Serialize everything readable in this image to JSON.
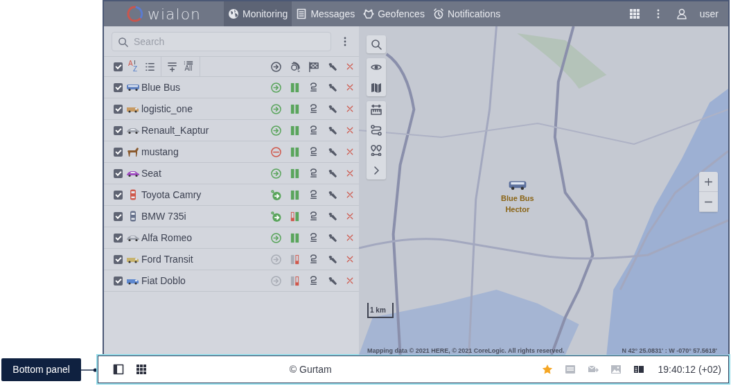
{
  "callout": {
    "label": "Bottom panel"
  },
  "top_bar": {
    "logo": "wialon",
    "tabs": [
      {
        "label": "Monitoring",
        "selected": true
      },
      {
        "label": "Messages",
        "selected": false
      },
      {
        "label": "Geofences",
        "selected": false
      },
      {
        "label": "Notifications",
        "selected": false
      }
    ],
    "user": "user"
  },
  "unit_list": {
    "search": {
      "placeholder": "Search"
    },
    "header": {
      "checked": true,
      "sort_letters": [
        "A",
        "Z"
      ],
      "all_label": "All"
    },
    "units": [
      {
        "name": "Blue Bus",
        "kind": "bus",
        "color": "#5d7fbf",
        "checked": true,
        "online": true,
        "stopped": false,
        "engine_on": false,
        "position_valid": true,
        "connected": true
      },
      {
        "name": "logistic_one",
        "kind": "van",
        "color": "#c79a62",
        "checked": true,
        "online": true,
        "stopped": false,
        "engine_on": false,
        "position_valid": true,
        "connected": true
      },
      {
        "name": "Renault_Kaptur",
        "kind": "car",
        "color": "#9ea3ad",
        "checked": true,
        "online": true,
        "stopped": false,
        "engine_on": false,
        "position_valid": true,
        "connected": true
      },
      {
        "name": "mustang",
        "kind": "horse",
        "color": "#8a5a2e",
        "checked": true,
        "online": true,
        "stopped": true,
        "engine_on": false,
        "position_valid": true,
        "connected": true
      },
      {
        "name": "Seat",
        "kind": "car",
        "color": "#a14fc2",
        "checked": true,
        "online": true,
        "stopped": false,
        "engine_on": false,
        "position_valid": true,
        "connected": true
      },
      {
        "name": "Toyota Camry",
        "kind": "topcar",
        "color": "#cf5a4c",
        "checked": true,
        "online": true,
        "stopped": false,
        "engine_on": true,
        "position_valid": true,
        "connected": true
      },
      {
        "name": "BMW 735i",
        "kind": "topcar",
        "color": "#67728c",
        "checked": true,
        "online": true,
        "stopped": false,
        "engine_on": true,
        "position_valid": false,
        "connected": true
      },
      {
        "name": "Alfa Romeo",
        "kind": "car",
        "color": "#9ea3ad",
        "checked": true,
        "online": true,
        "stopped": false,
        "engine_on": false,
        "position_valid": true,
        "connected": true
      },
      {
        "name": "Ford Transit",
        "kind": "van",
        "color": "#c7b36e",
        "checked": true,
        "online": false,
        "stopped": false,
        "engine_on": false,
        "position_valid": true,
        "connected": false
      },
      {
        "name": "Fiat Doblo",
        "kind": "van",
        "color": "#5e88cf",
        "checked": true,
        "online": false,
        "stopped": false,
        "engine_on": false,
        "position_valid": true,
        "connected": false
      }
    ]
  },
  "map": {
    "unit_labels": [
      "Blue Bus",
      "Hector"
    ],
    "scale": "1 km",
    "attribution": "Mapping data © 2021 HERE, © 2021 CoreLogic. All rights reserved.",
    "coordinates": "N 42° 25.0831' : W -070° 57.5618'"
  },
  "bottom_panel": {
    "copyright": "© Gurtam",
    "favorite": true,
    "time": "19:40:12 (+02)"
  }
}
